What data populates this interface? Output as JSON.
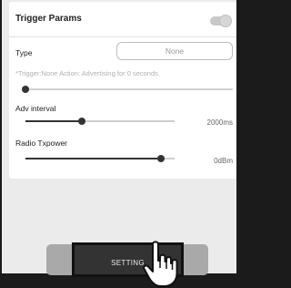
{
  "header": {
    "title": "Trigger Params",
    "toggle_on": false
  },
  "type": {
    "label": "Type",
    "value": "None"
  },
  "hint": "*Trigger:None   Action: Advertising for 0 seconds.",
  "trigger_slider": {
    "level": 0
  },
  "adv_interval": {
    "label": "Adv interval",
    "value": "2000ms",
    "level": 0.38
  },
  "tx_power": {
    "label": "Radio Txpower",
    "value": "0dBm",
    "level": 0.91
  },
  "setting_button": {
    "label": "SETTING"
  },
  "icons": {
    "cursor": "hand-pointer-icon"
  },
  "colors": {
    "accent": "#333333",
    "background": "#ebebeb",
    "card": "#ffffff"
  }
}
